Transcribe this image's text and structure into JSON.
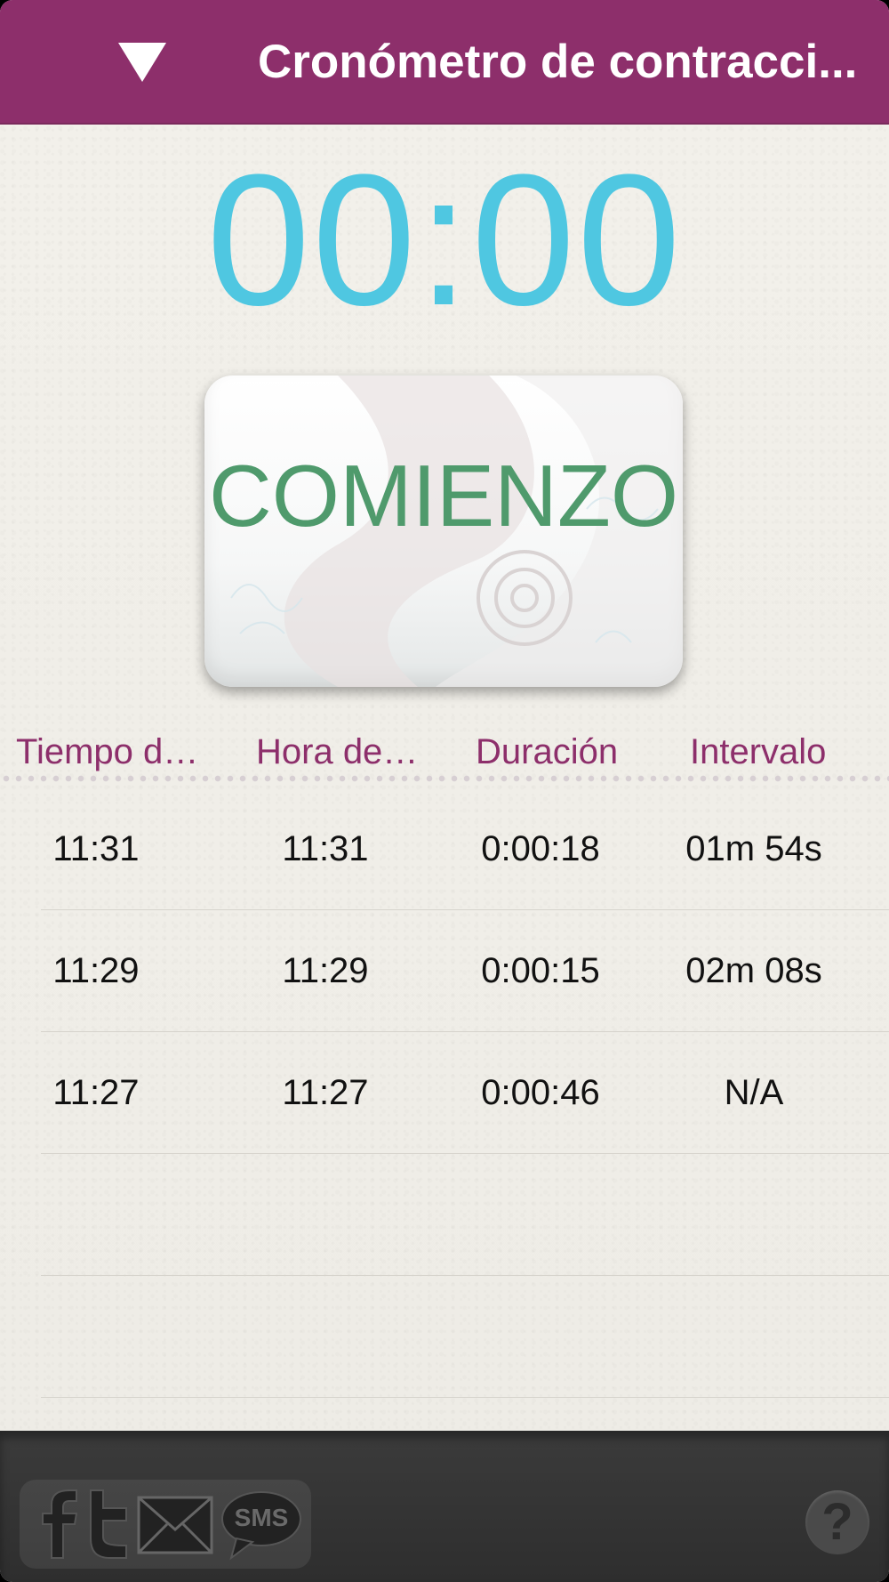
{
  "colors": {
    "header_bg": "#8d2f6b",
    "timer": "#4fc7e1",
    "start_label": "#4f9a6c",
    "column_header": "#8d2f6b",
    "footer_bg": "#333333"
  },
  "header": {
    "title": "Cronómetro de contracci...",
    "menu_icon": "triangle-down-icon"
  },
  "timer": {
    "display": "00:00"
  },
  "start_button": {
    "label": "COMIENZO"
  },
  "table": {
    "columns": [
      "Tiempo d…",
      "Hora de…",
      "Duración",
      "Intervalo"
    ],
    "rows": [
      {
        "start": "11:31",
        "end": "11:31",
        "duration": "0:00:18",
        "interval": "01m 54s"
      },
      {
        "start": "11:29",
        "end": "11:29",
        "duration": "0:00:15",
        "interval": "02m 08s"
      },
      {
        "start": "11:27",
        "end": "11:27",
        "duration": "0:00:46",
        "interval": "N/A"
      }
    ]
  },
  "footer": {
    "share_icons": [
      "facebook-icon",
      "twitter-icon",
      "mail-icon",
      "sms-icon"
    ],
    "sms_label": "SMS",
    "help_label": "?"
  }
}
